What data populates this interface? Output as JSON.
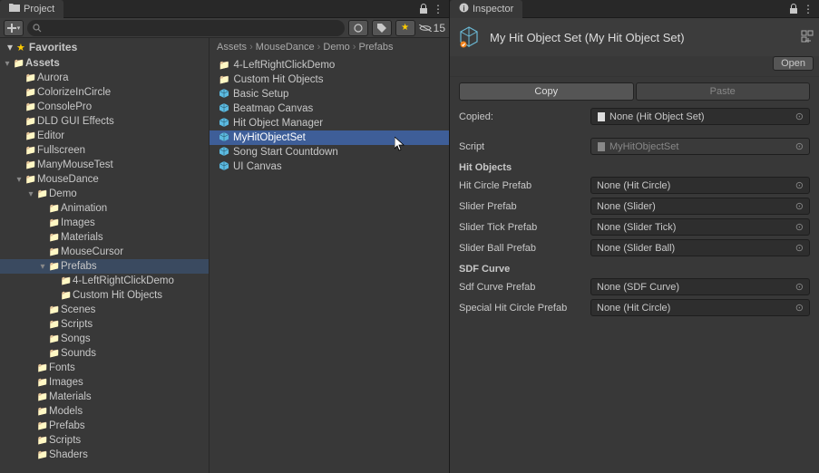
{
  "project_tab": "Project",
  "inspector_tab": "Inspector",
  "toolbar": {
    "search_placeholder": "",
    "hidden_count": "15"
  },
  "favorites_label": "Favorites",
  "tree": {
    "root": "Assets",
    "items": [
      {
        "label": "Aurora"
      },
      {
        "label": "ColorizeInCircle"
      },
      {
        "label": "ConsolePro"
      },
      {
        "label": "DLD GUI Effects"
      },
      {
        "label": "Editor"
      },
      {
        "label": "Fullscreen"
      },
      {
        "label": "ManyMouseTest"
      },
      {
        "label": "MouseDance",
        "open": true,
        "children": [
          {
            "label": "Demo",
            "open": true,
            "children": [
              {
                "label": "Animation"
              },
              {
                "label": "Images"
              },
              {
                "label": "Materials"
              },
              {
                "label": "MouseCursor"
              },
              {
                "label": "Prefabs",
                "open": true,
                "active": true,
                "children": [
                  {
                    "label": "4-LeftRightClickDemo"
                  },
                  {
                    "label": "Custom Hit Objects"
                  }
                ]
              },
              {
                "label": "Scenes"
              },
              {
                "label": "Scripts"
              },
              {
                "label": "Songs"
              },
              {
                "label": "Sounds"
              }
            ]
          },
          {
            "label": "Fonts"
          },
          {
            "label": "Images"
          },
          {
            "label": "Materials"
          },
          {
            "label": "Models"
          },
          {
            "label": "Prefabs"
          },
          {
            "label": "Scripts"
          },
          {
            "label": "Shaders"
          }
        ]
      }
    ]
  },
  "breadcrumb": [
    "Assets",
    "MouseDance",
    "Demo",
    "Prefabs"
  ],
  "content": [
    {
      "label": "4-LeftRightClickDemo",
      "type": "folder"
    },
    {
      "label": "Custom Hit Objects",
      "type": "folder"
    },
    {
      "label": "Basic Setup",
      "type": "prefab"
    },
    {
      "label": "Beatmap Canvas",
      "type": "prefab"
    },
    {
      "label": "Hit Object Manager",
      "type": "prefab"
    },
    {
      "label": "MyHitObjectSet",
      "type": "prefab",
      "selected": true
    },
    {
      "label": "Song Start Countdown",
      "type": "prefab"
    },
    {
      "label": "UI Canvas",
      "type": "prefab"
    }
  ],
  "inspector": {
    "title": "My Hit Object Set (My Hit Object Set)",
    "open_btn": "Open",
    "copy_btn": "Copy",
    "paste_btn": "Paste",
    "copied_label": "Copied:",
    "copied_value": "None (Hit Object Set)",
    "script_label": "Script",
    "script_value": "MyHitObjectSet",
    "sections": [
      {
        "title": "Hit Objects",
        "props": [
          {
            "label": "Hit Circle Prefab",
            "value": "None (Hit Circle)"
          },
          {
            "label": "Slider Prefab",
            "value": "None (Slider)"
          },
          {
            "label": "Slider Tick Prefab",
            "value": "None (Slider Tick)"
          },
          {
            "label": "Slider Ball Prefab",
            "value": "None (Slider Ball)"
          }
        ]
      },
      {
        "title": "SDF Curve",
        "props": [
          {
            "label": "Sdf Curve Prefab",
            "value": "None (SDF Curve)"
          },
          {
            "label": "Special Hit Circle Prefab",
            "value": "None (Hit Circle)"
          }
        ]
      }
    ]
  }
}
